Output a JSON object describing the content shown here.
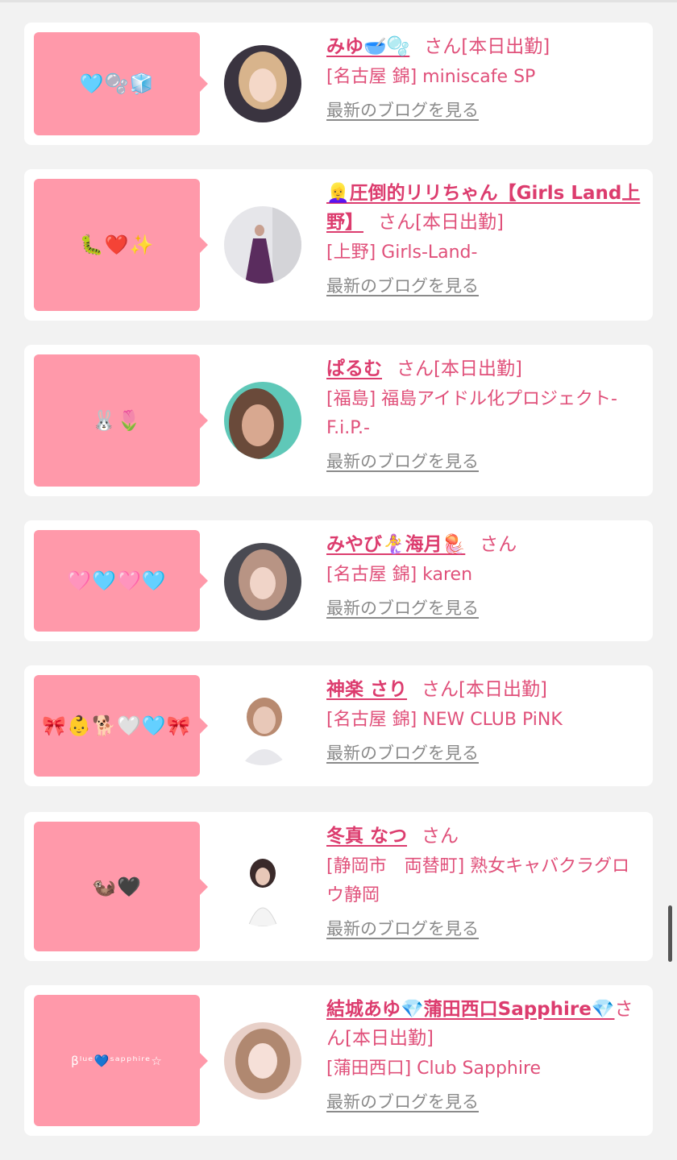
{
  "cards": [
    {
      "bubble": "🩵🫧🧊",
      "name": "みゆ🥣🫧",
      "san": "さん",
      "status": "[本日出勤]",
      "shop": "[名古屋 錦] miniscafe SP",
      "blog_link": "最新のブログを見る",
      "avatar_colors": [
        "#d8b48c",
        "#3a3440"
      ]
    },
    {
      "bubble": "🐛❤️✨",
      "name": "👱‍♀️圧倒的リリちゃん【Girls Land上野】",
      "san": "さん",
      "status": "[本日出勤]",
      "shop": "[上野] Girls-Land-",
      "blog_link": "最新のブログを見る",
      "avatar_colors": [
        "#e6e6ea",
        "#5a2c5e"
      ]
    },
    {
      "bubble": "🐰🌷",
      "name": "ぱるむ",
      "san": "さん",
      "status": "[本日出勤]",
      "shop": "[福島] 福島アイドル化プロジェクト-F.i.P.-",
      "blog_link": "最新のブログを見る",
      "avatar_colors": [
        "#5fc8b8",
        "#d8a890"
      ]
    },
    {
      "bubble": "🩷🩵🩷🩵",
      "name": "みやび🧜‍♀️海月🪼",
      "san": "さん",
      "status": "",
      "shop": "[名古屋 錦] karen",
      "blog_link": "最新のブログを見る",
      "avatar_colors": [
        "#b89484",
        "#4a4a52"
      ]
    },
    {
      "bubble": "🎀👶🐕🤍🩵🎀",
      "name": "神楽 さり",
      "san": "さん",
      "status": "[本日出勤]",
      "shop": "[名古屋 錦] NEW CLUB PiNK",
      "blog_link": "最新のブログを見る",
      "avatar_colors": [
        "#ffffff",
        "#e8c8b8"
      ]
    },
    {
      "bubble": "🦦🖤",
      "name": "冬真 なつ",
      "san": "さん",
      "status": "",
      "shop": "[静岡市　両替町] 熟女キャバクラグロウ静岡",
      "blog_link": "最新のブログを見る",
      "avatar_colors": [
        "#ffffff",
        "#3a2a2a"
      ]
    },
    {
      "bubble": "βˡᵘᵉ💙ˢᵃᵖᵖʰⁱʳᵉ☆",
      "name": "結城あゆ💎蒲田西口Sapphire💎",
      "san": "さん",
      "status": "[本日出勤]",
      "shop": "[蒲田西口] Club Sapphire",
      "blog_link": "最新のブログを見る",
      "avatar_colors": [
        "#e8d0c8",
        "#b08870"
      ]
    }
  ]
}
